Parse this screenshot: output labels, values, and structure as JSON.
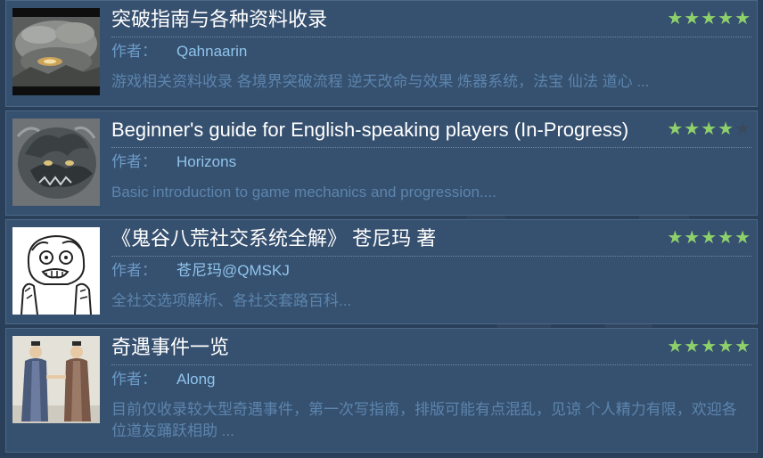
{
  "guides": [
    {
      "title": "突破指南与各种资料收录",
      "author_label": "作者：",
      "author": "Qahnaarin",
      "description": "游戏相关资料收录 各境界突破流程 逆天改命与效果 炼器系统，法宝 仙法 道心 ...",
      "rating_filled": 5,
      "thumbnail_icon": "misty-landscape-thumbnail"
    },
    {
      "title": "Beginner's guide for English-speaking players (In-Progress)",
      "author_label": "作者：",
      "author": "Horizons",
      "description": "Basic introduction to game mechanics and progression....",
      "rating_filled": 4,
      "thumbnail_icon": "dragon-thumbnail"
    },
    {
      "title": "《鬼谷八荒社交系统全解》 苍尼玛 著",
      "author_label": "作者：",
      "author": "苍尼玛@QMSKJ",
      "description": "全社交选项解析、各社交套路百科...",
      "rating_filled": 5,
      "thumbnail_icon": "meme-face-thumbnail"
    },
    {
      "title": "奇遇事件一览",
      "author_label": "作者：",
      "author": "Along",
      "description": "目前仅收录较大型奇遇事件，第一次写指南，排版可能有点混乱，见谅 个人精力有限，欢迎各位道友踊跃相助 ...",
      "rating_filled": 5,
      "thumbnail_icon": "two-scholars-thumbnail"
    }
  ],
  "colors": {
    "background": "#2a3f5a",
    "card": "#36506f",
    "star_filled": "#8ed16b",
    "star_empty": "#3a4a5e",
    "title": "#ffffff",
    "author_name": "#90c4ec",
    "description": "#5c85ad"
  }
}
